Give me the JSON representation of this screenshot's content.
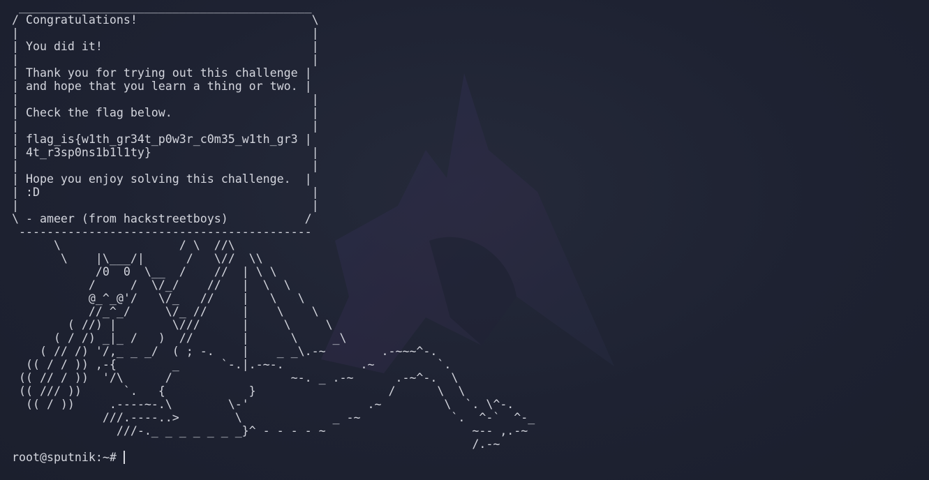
{
  "terminal": {
    "output_lines": [
      " __________________________________________",
      "/ Congratulations!                         \\",
      "|                                          |",
      "| You did it!                              |",
      "|                                          |",
      "| Thank you for trying out this challenge |",
      "| and hope that you learn a thing or two. |",
      "|                                          |",
      "| Check the flag below.                    |",
      "|                                          |",
      "| flag_is{w1th_gr34t_p0w3r_c0m35_w1th_gr3 |",
      "| 4t_r3sp0ns1b1l1ty}                       |",
      "|                                          |",
      "| Hope you enjoy solving this challenge.  |",
      "| :D                                       |",
      "|                                          |",
      "\\ - ameer (from hackstreetboys)           /",
      " ------------------------------------------",
      "      \\                 / \\  //\\",
      "       \\    |\\___/|      /   \\//  \\\\",
      "            /0  0  \\__  /    //  | \\ \\",
      "           /     /  \\/_/    //   |  \\  \\",
      "           @_^_@'/   \\/_   //    |   \\   \\",
      "           //_^_/     \\/_ //     |    \\    \\",
      "        ( //) |        \\///      |     \\     \\",
      "      ( / /) _|_ /   )  //       |      \\     _\\",
      "    ( // /) '/,_ _ _/  ( ; -.    |    _ _\\.-~        .-~~~^-.",
      "  (( / / )) ,-{        _      `-.|.-~-.           .~         `.",
      " (( // / ))  '/\\      /                 ~-. _ .-~      .-~^-.  \\",
      " (( /// ))      `.   {            }                   /      \\  \\",
      "  (( / ))     .----~-.\\        \\-'                 .~         \\  `. \\^-.",
      "             ///.----..>        \\             _ -~             `.  ^-`  ^-_",
      "               ///-._ _ _ _ _ _ _}^ - - - - ~                     ~-- ,.-~",
      "                                                                  /.-~"
    ],
    "prompt": "root@sputnik:~#"
  },
  "colors": {
    "background": "#1d2231",
    "foreground": "#d4d6de",
    "watermark": "#2d3350"
  }
}
